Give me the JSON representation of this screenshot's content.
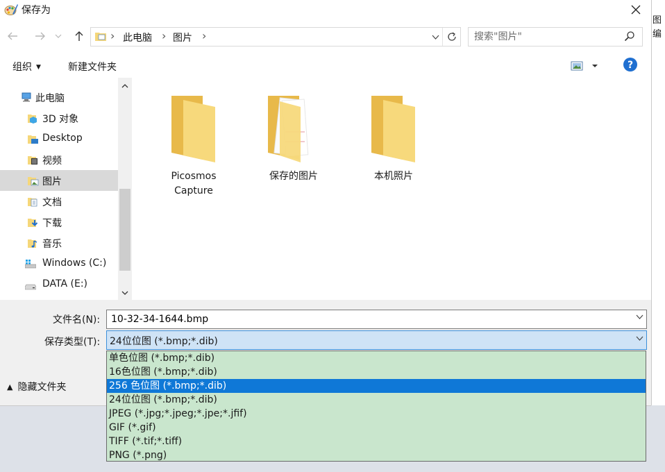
{
  "window": {
    "title": "保存为"
  },
  "background_app": {
    "text_lines": [
      "图",
      "编"
    ]
  },
  "address_bar": {
    "crumbs": [
      "此电脑",
      "图片"
    ]
  },
  "search": {
    "placeholder": "搜索\"图片\""
  },
  "toolbar": {
    "organize_label": "组织",
    "new_folder_label": "新建文件夹"
  },
  "nav_pane": {
    "items": [
      {
        "label": "此电脑",
        "icon": "computer-icon"
      },
      {
        "label": "3D 对象",
        "icon": "3d-objects-icon"
      },
      {
        "label": "Desktop",
        "icon": "desktop-folder-icon"
      },
      {
        "label": "视频",
        "icon": "videos-folder-icon"
      },
      {
        "label": "图片",
        "icon": "pictures-folder-icon",
        "selected": true
      },
      {
        "label": "文档",
        "icon": "documents-folder-icon"
      },
      {
        "label": "下载",
        "icon": "downloads-folder-icon"
      },
      {
        "label": "音乐",
        "icon": "music-folder-icon"
      },
      {
        "label": "Windows (C:)",
        "icon": "windows-drive-icon"
      },
      {
        "label": "DATA (E:)",
        "icon": "drive-icon"
      }
    ]
  },
  "folders": [
    {
      "label_line1": "Picosmos",
      "label_line2": "Capture"
    },
    {
      "label_line1": "保存的图片",
      "label_line2": ""
    },
    {
      "label_line1": "本机照片",
      "label_line2": ""
    }
  ],
  "form": {
    "filename_label": "文件名(N):",
    "filename_value": "10-32-34-1644.bmp",
    "filetype_label": "保存类型(T):",
    "filetype_value": "24位位图 (*.bmp;*.dib)",
    "hide_folders_label": "隐藏文件夹"
  },
  "filetype_options": [
    "单色位图 (*.bmp;*.dib)",
    "16色位图 (*.bmp;*.dib)",
    "256 色位图 (*.bmp;*.dib)",
    "24位位图 (*.bmp;*.dib)",
    "JPEG (*.jpg;*.jpeg;*.jpe;*.jfif)",
    "GIF (*.gif)",
    "TIFF (*.tif;*.tiff)",
    "PNG (*.png)"
  ],
  "selected_option_index": 2,
  "colors": {
    "selection_blue": "#0f78d7",
    "dropdown_bg": "#c9e6cd",
    "folder_yellow": "#f5d77a",
    "help_blue": "#1f6fd0"
  }
}
